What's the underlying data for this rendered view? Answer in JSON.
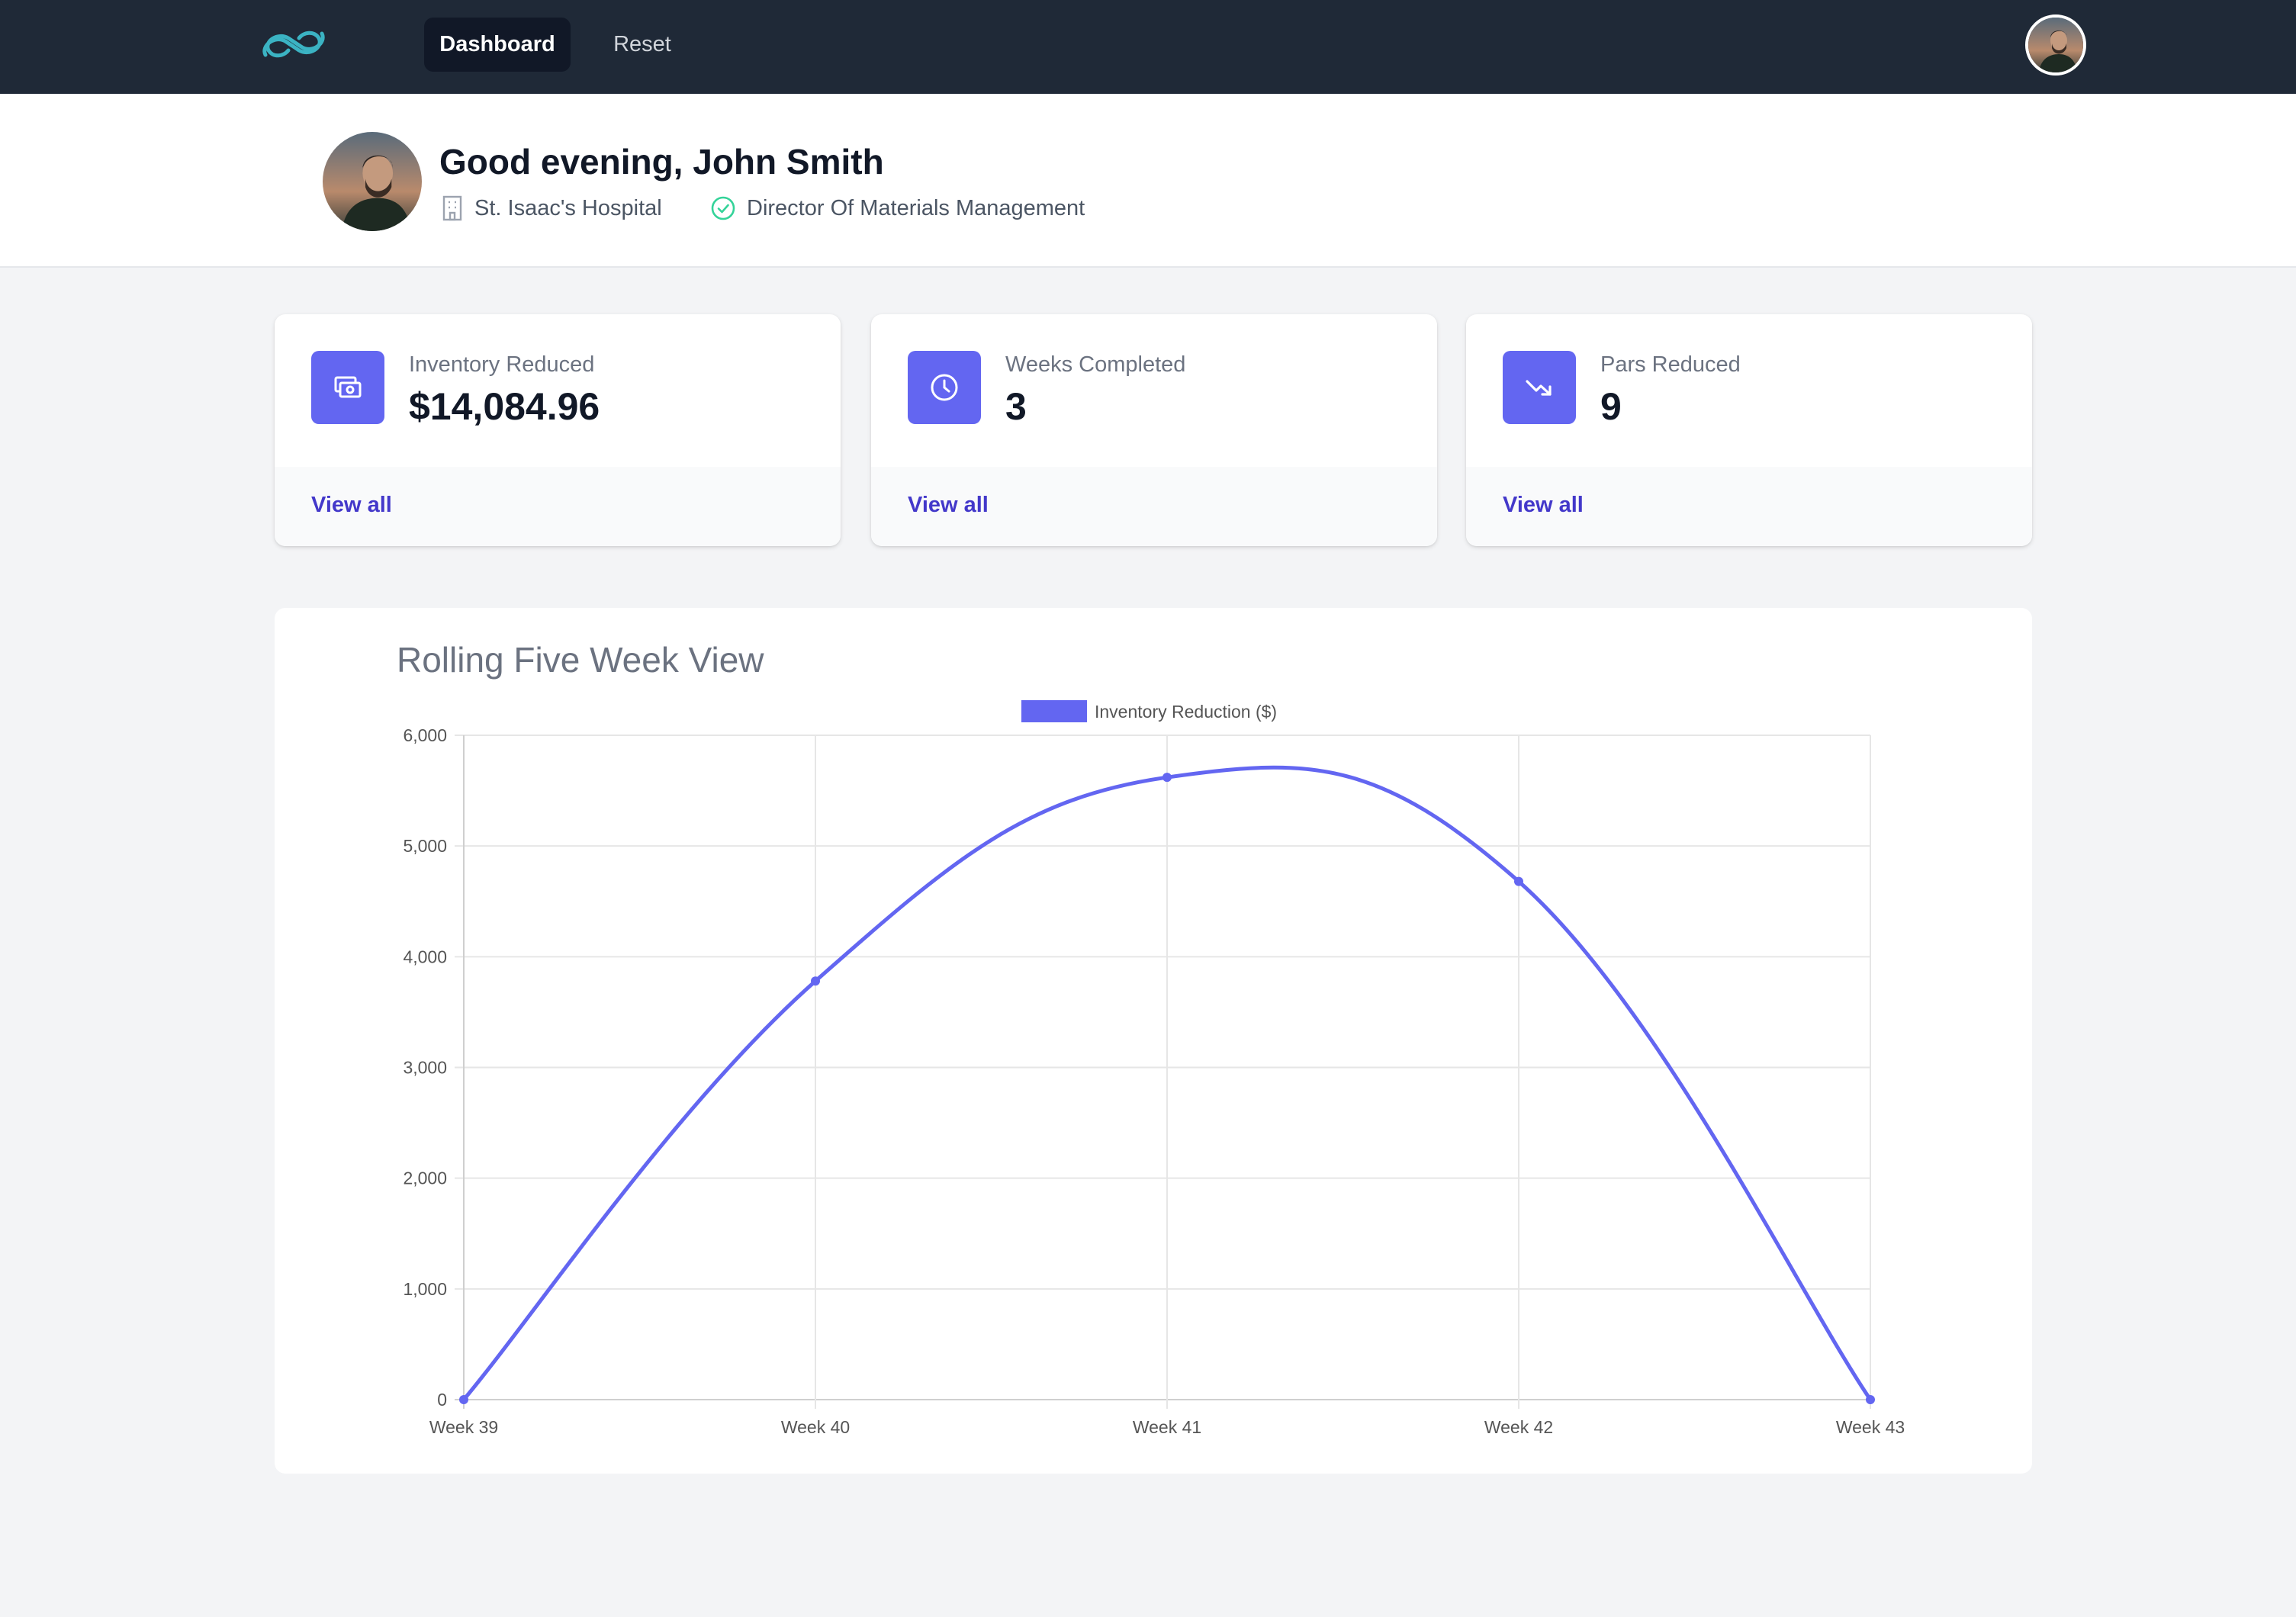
{
  "nav": {
    "items": [
      {
        "label": "Dashboard",
        "active": true
      },
      {
        "label": "Reset",
        "active": false
      }
    ],
    "logo_icon": "infinity-logo-icon",
    "avatar_icon": "user-avatar-icon"
  },
  "header": {
    "greeting": "Good evening, John Smith",
    "hospital": "St. Isaac's Hospital",
    "hospital_icon": "building-icon",
    "role": "Director Of Materials Management",
    "role_icon": "check-circle-icon"
  },
  "stats": [
    {
      "label": "Inventory Reduced",
      "value": "$14,084.96",
      "link": "View all",
      "icon": "cash-icon"
    },
    {
      "label": "Weeks Completed",
      "value": "3",
      "link": "View all",
      "icon": "clock-icon"
    },
    {
      "label": "Pars Reduced",
      "value": "9",
      "link": "View all",
      "icon": "trending-down-icon"
    }
  ],
  "colors": {
    "accent": "#6366f1",
    "nav_bg": "#1f2937",
    "link": "#4338ca"
  },
  "chart_data": {
    "type": "line",
    "title": "Rolling Five Week View",
    "categories": [
      "Week 39",
      "Week 40",
      "Week 41",
      "Week 42",
      "Week 43"
    ],
    "series": [
      {
        "name": "Inventory Reduction ($)",
        "values": [
          0,
          3780,
          5620,
          4680,
          0
        ],
        "color": "#6366f1"
      }
    ],
    "ylim": [
      0,
      6000
    ],
    "yticks": [
      "0",
      "1,000",
      "2,000",
      "3,000",
      "4,000",
      "5,000",
      "6,000"
    ],
    "grid": true,
    "legend": "top-center",
    "smooth": true
  }
}
